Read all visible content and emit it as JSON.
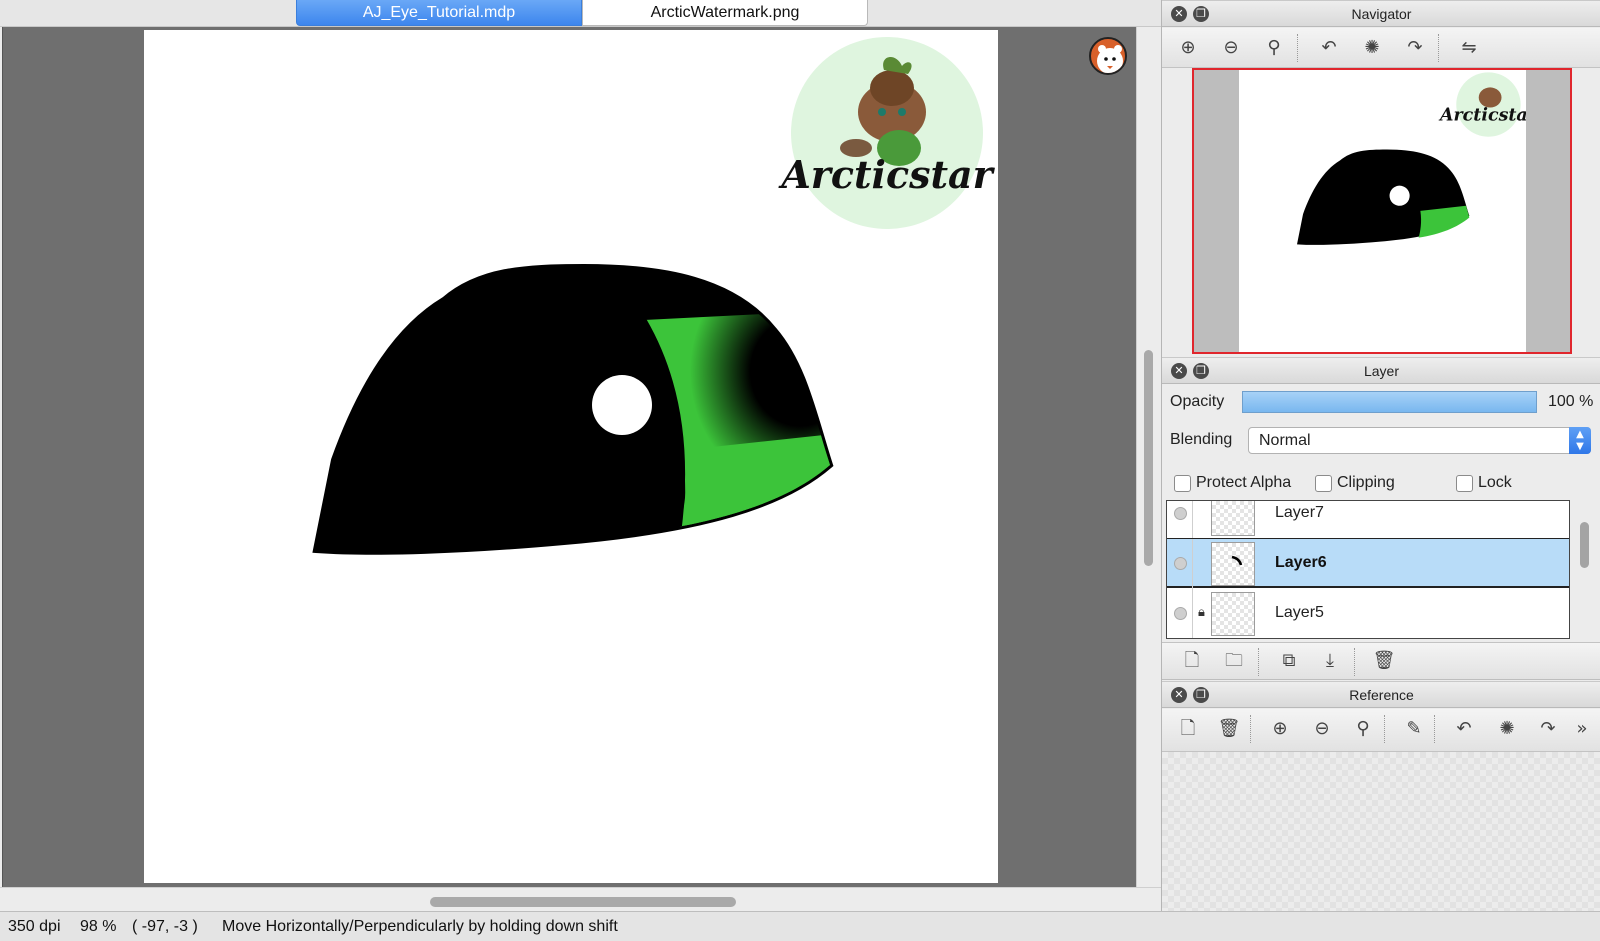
{
  "tabs": [
    {
      "label": "AJ_Eye_Tutorial.mdp",
      "active": true
    },
    {
      "label": "ArcticWatermark.png",
      "active": false
    }
  ],
  "canvas": {
    "watermark_text": "Arcticstar",
    "eye_color": "#000000",
    "iris_color": "#3cc43a",
    "highlight_color": "#ffffff",
    "watermark_bg": "#dff5df"
  },
  "status_bar": {
    "dpi": "350 dpi",
    "zoom": "98 %",
    "coords": "( -97, -3 )",
    "message": "Move Horizontally/Perpendicularly by holding down shift"
  },
  "navigator": {
    "title": "Navigator",
    "tools": [
      "zoom-in-icon",
      "zoom-out-icon",
      "zoom-reset-icon",
      "rotate-left-icon",
      "rotate-reset-icon",
      "rotate-right-icon",
      "flip-icon"
    ],
    "view_frame_color": "#e0262d"
  },
  "layer_panel": {
    "title": "Layer",
    "opacity_label": "Opacity",
    "opacity_value": "100 %",
    "blending_label": "Blending",
    "blending_value": "Normal",
    "checkboxes": [
      {
        "label": "Protect Alpha",
        "checked": false
      },
      {
        "label": "Clipping",
        "checked": false
      },
      {
        "label": "Lock",
        "checked": false
      }
    ],
    "layers": [
      {
        "name": "Layer7",
        "selected": false,
        "locked": false
      },
      {
        "name": "Layer6",
        "selected": true,
        "locked": false
      },
      {
        "name": "Layer5",
        "selected": false,
        "locked": true
      }
    ],
    "buttons": [
      "new-layer-icon",
      "new-folder-icon",
      "duplicate-layer-icon",
      "merge-down-icon",
      "delete-layer-icon"
    ]
  },
  "reference": {
    "title": "Reference",
    "tools": [
      "new-icon",
      "delete-icon",
      "zoom-in-icon",
      "zoom-out-icon",
      "zoom-reset-icon",
      "eyedropper-icon",
      "rotate-left-icon",
      "rotate-reset-icon",
      "rotate-right-icon",
      "more-icon"
    ]
  },
  "colors": {
    "accent": "#3d86ee",
    "selection": "#b8dcf8",
    "canvas_bg": "#6f6f6f"
  }
}
